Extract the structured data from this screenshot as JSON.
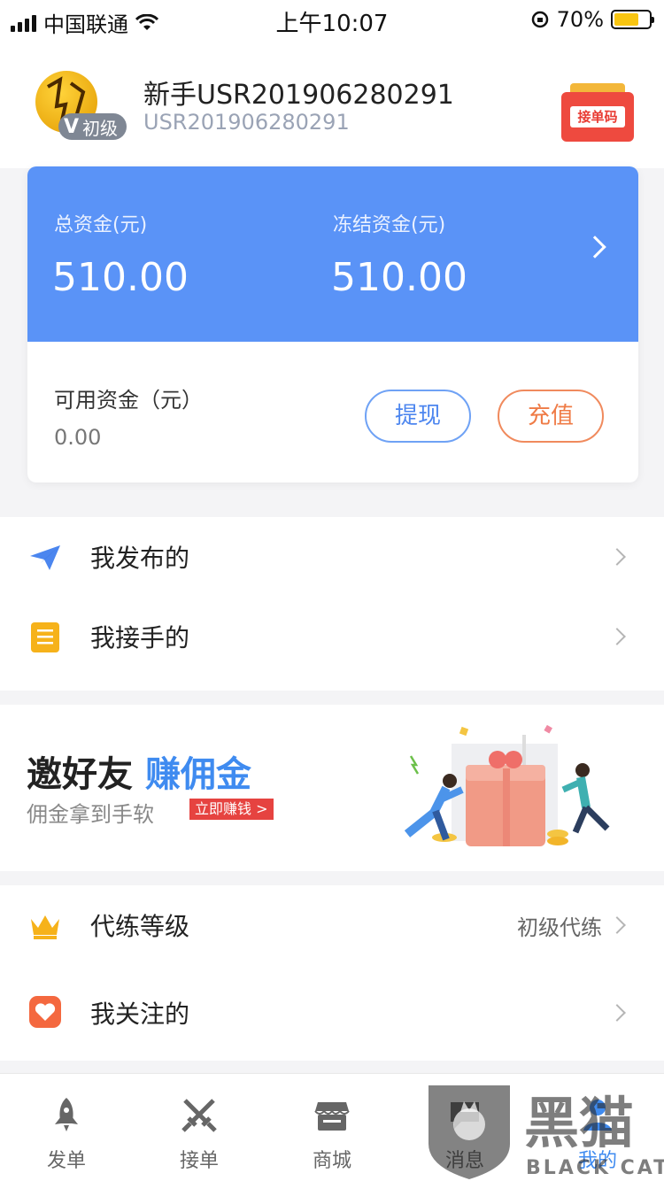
{
  "status_bar": {
    "carrier": "中国联通",
    "time": "上午10:07",
    "battery": "70%"
  },
  "profile": {
    "level_badge": "初级",
    "badge_letter": "V",
    "name": "新手USR201906280291",
    "id": "USR201906280291",
    "order_code_label": "接单码"
  },
  "assets": {
    "total_label": "总资金(元)",
    "total_value": "510.00",
    "frozen_label": "冻结资金(元)",
    "frozen_value": "510.00",
    "available_label": "可用资金（元）",
    "available_value": "0.00",
    "withdraw_label": "提现",
    "recharge_label": "充值"
  },
  "menu1": {
    "published": "我发布的",
    "accepted": "我接手的"
  },
  "banner": {
    "title_main": "邀好友",
    "title_highlight": "赚佣金",
    "subtitle": "佣金拿到手软",
    "cta": "立即赚钱 >"
  },
  "menu2": {
    "level_label": "代练等级",
    "level_value": "初级代练",
    "following": "我关注的"
  },
  "tabbar": {
    "tabs": [
      {
        "label": "发单",
        "icon": "rocket-icon"
      },
      {
        "label": "接单",
        "icon": "crossed-swords-icon"
      },
      {
        "label": "商城",
        "icon": "store-icon"
      },
      {
        "label": "消息",
        "icon": "chat-icon"
      },
      {
        "label": "我的",
        "icon": "user-icon"
      }
    ],
    "active_index": 4
  },
  "watermark": {
    "brand_cn": "黑猫",
    "brand_en": "BLACK CAT"
  },
  "colors": {
    "primary": "#5a93f7",
    "accent_orange": "#ef7b46",
    "red": "#e64340"
  }
}
